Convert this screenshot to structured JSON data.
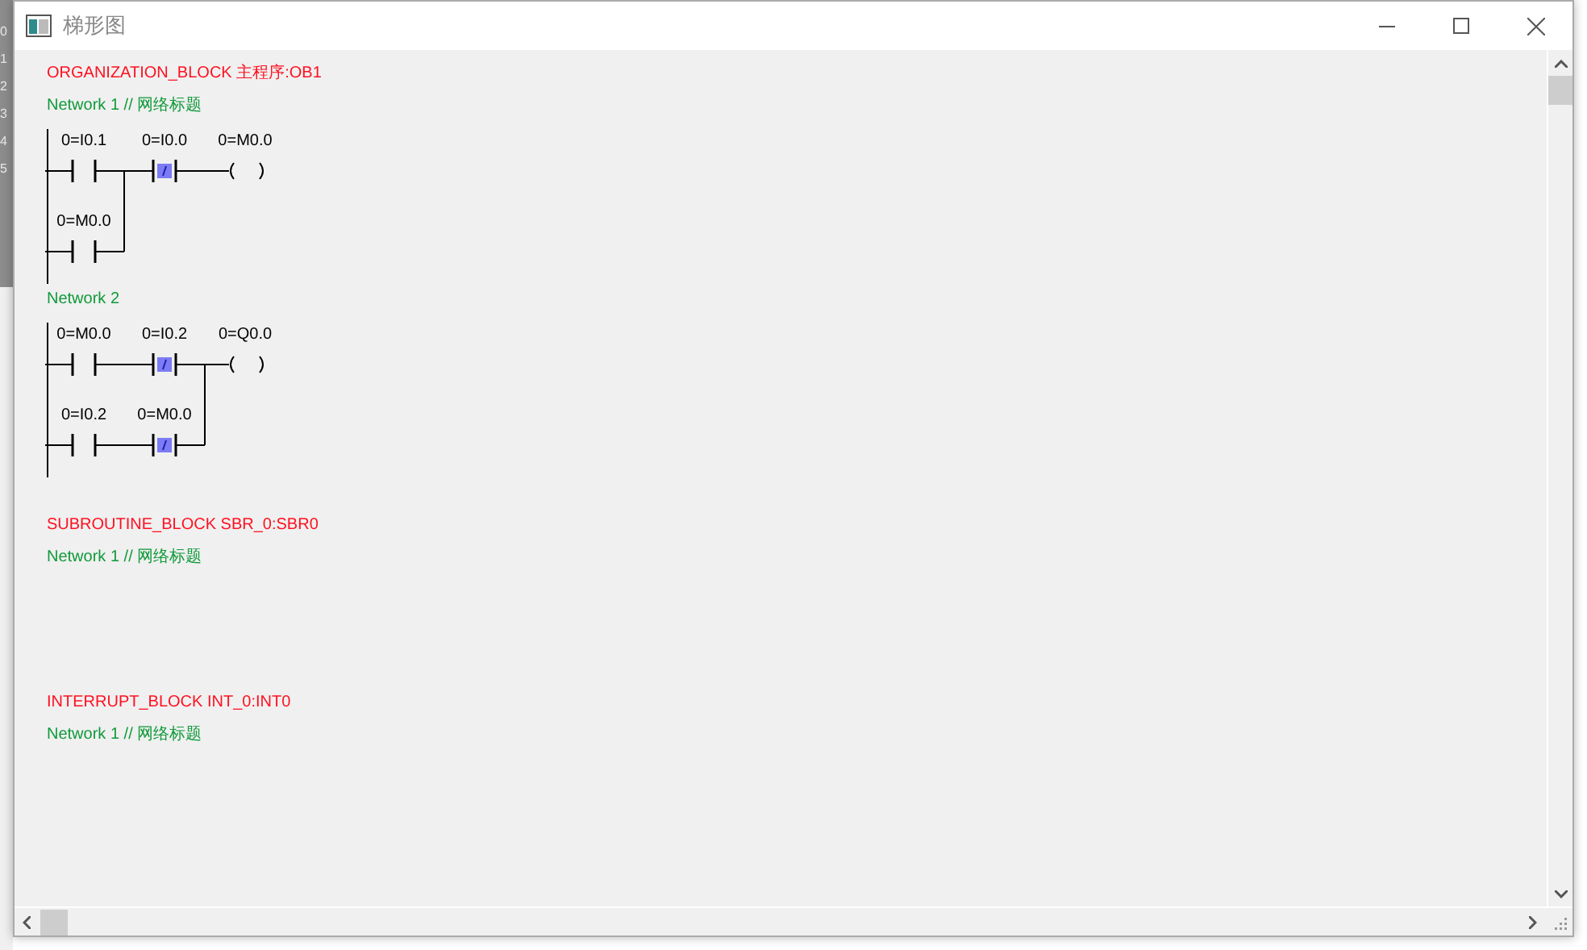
{
  "background_app": {
    "row_numbers": [
      "0",
      "1",
      "2",
      "3",
      "4",
      "5"
    ]
  },
  "window": {
    "title": "梯形图"
  },
  "blocks": [
    {
      "title": "ORGANIZATION_BLOCK 主程序:OB1",
      "networks": [
        {
          "title": "Network 1 // 网络标题",
          "rows": [
            [
              {
                "kind": "no",
                "label": "0=I0.1"
              },
              {
                "kind": "nc",
                "label": "0=I0.0"
              },
              {
                "kind": "coil",
                "label": "0=M0.0"
              }
            ],
            [
              {
                "kind": "no",
                "label": "0=M0.0"
              }
            ]
          ]
        },
        {
          "title": "Network 2",
          "rows": [
            [
              {
                "kind": "no",
                "label": "0=M0.0"
              },
              {
                "kind": "nc",
                "label": "0=I0.2"
              },
              {
                "kind": "coil",
                "label": "0=Q0.0"
              }
            ],
            [
              {
                "kind": "no",
                "label": "0=I0.2"
              },
              {
                "kind": "nc",
                "label": "0=M0.0"
              }
            ]
          ]
        }
      ]
    },
    {
      "title": "SUBROUTINE_BLOCK SBR_0:SBR0",
      "networks": [
        {
          "title": "Network 1 // 网络标题"
        }
      ]
    },
    {
      "title": "INTERRUPT_BLOCK INT_0:INT0",
      "networks": [
        {
          "title": "Network 1 // 网络标题"
        }
      ]
    }
  ]
}
